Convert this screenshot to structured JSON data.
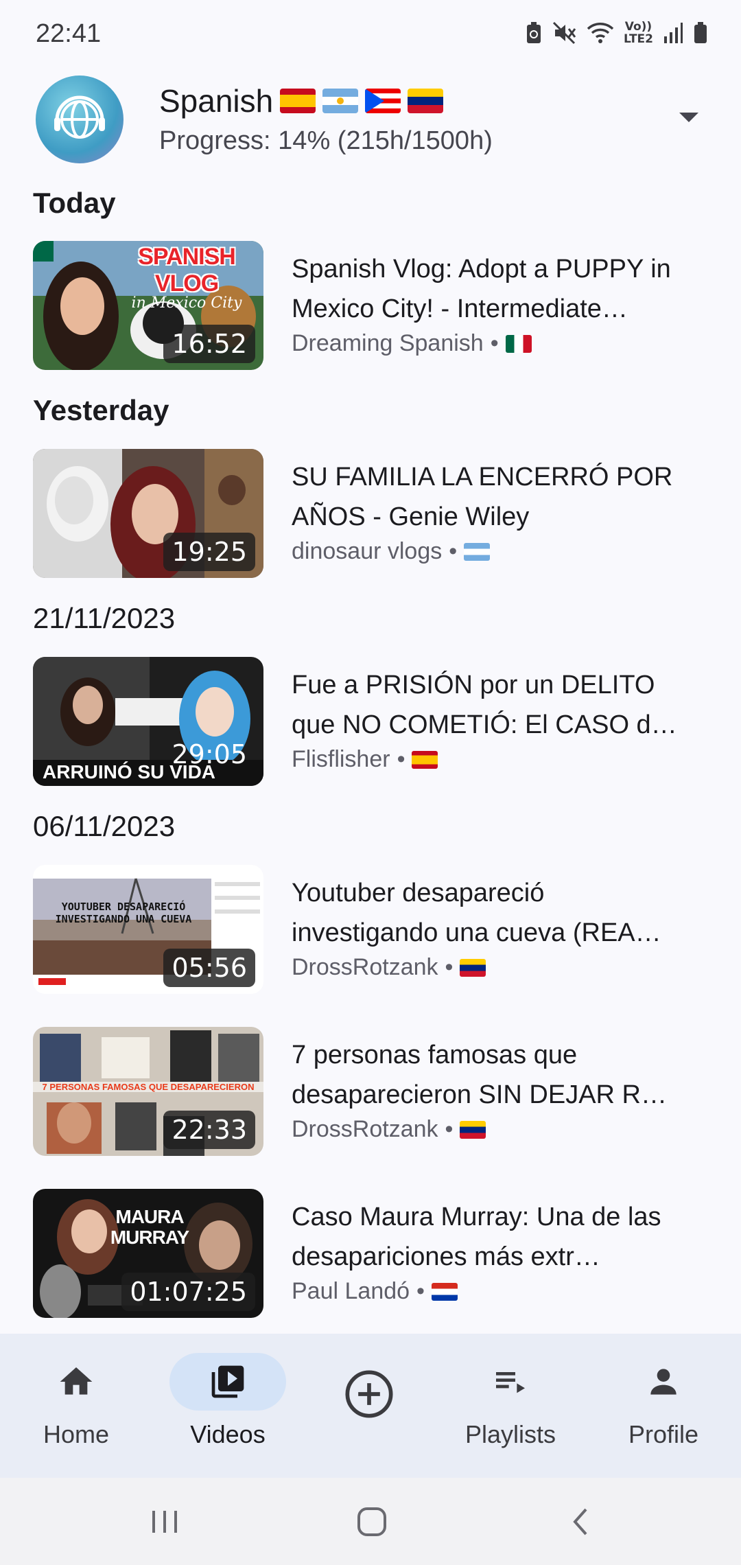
{
  "status_bar": {
    "time": "22:41",
    "network_label_top": "Vo))",
    "network_label_bottom": "LTE2"
  },
  "language": {
    "name": "Spanish",
    "progress_text": "Progress: 14% (215h/1500h)",
    "progress_fraction": 0.14,
    "flags": [
      "spain-flag",
      "argentina-flag",
      "puerto-rico-flag",
      "venezuela-flag"
    ]
  },
  "feed": {
    "sections": [
      {
        "heading": "Today"
      },
      {
        "heading": "Yesterday"
      },
      {
        "heading": "21/11/2023"
      },
      {
        "heading": "06/11/2023"
      }
    ],
    "videos": [
      {
        "title": "Spanish Vlog: Adopt a PUPPY in Mexico City! - Intermediate…",
        "channel": "Dreaming Spanish",
        "flag": "mexico-flag",
        "duration": "16:52",
        "thumb_text_1": "SPANISH VLOG",
        "thumb_text_2": "in Mexico City"
      },
      {
        "title": "SU FAMILIA LA ENCERRÓ POR AÑOS - Genie Wiley",
        "channel": "dinosaur vlogs",
        "flag": "argentina-flag",
        "duration": "19:25"
      },
      {
        "title": "Fue a PRISIÓN por un DELITO que NO COMETIÓ: El CASO d…",
        "channel": "Flisflisher",
        "flag": "spain-flag",
        "duration": "29:05",
        "thumb_text_1": "ARRUINÓ SU VIDA"
      },
      {
        "title": "Youtuber desapareció investigando una cueva (REA…",
        "channel": "DrossRotzank",
        "flag": "venezuela-flag",
        "duration": "05:56",
        "thumb_text_1": "YOUTUBER DESAPARECIÓ",
        "thumb_text_2": "INVESTIGANDO UNA CUEVA"
      },
      {
        "title": "7 personas famosas que desaparecieron SIN DEJAR R…",
        "channel": "DrossRotzank",
        "flag": "venezuela-flag",
        "duration": "22:33",
        "thumb_text_1": "7 PERSONAS FAMOSAS QUE DESAPARECIERON"
      },
      {
        "title": "Caso Maura Murray: Una de las desapariciones más extr…",
        "channel": "Paul Landó",
        "flag": "paraguay-flag",
        "duration": "01:07:25",
        "thumb_text_1": "MAURA",
        "thumb_text_2": "MURRAY"
      }
    ]
  },
  "bottom_nav": {
    "items": [
      {
        "label": "Home",
        "icon": "home-icon"
      },
      {
        "label": "Videos",
        "icon": "video-library-icon",
        "active": true
      },
      {
        "label": "",
        "icon": "add-circle-icon"
      },
      {
        "label": "Playlists",
        "icon": "playlist-icon"
      },
      {
        "label": "Profile",
        "icon": "person-icon"
      }
    ]
  },
  "colors": {
    "background": "#f9f9fd",
    "nav_background": "#e9edf6",
    "nav_active_pill": "#d4e3f7",
    "text_primary": "#1b1b1f",
    "text_secondary": "#5e5e68"
  }
}
